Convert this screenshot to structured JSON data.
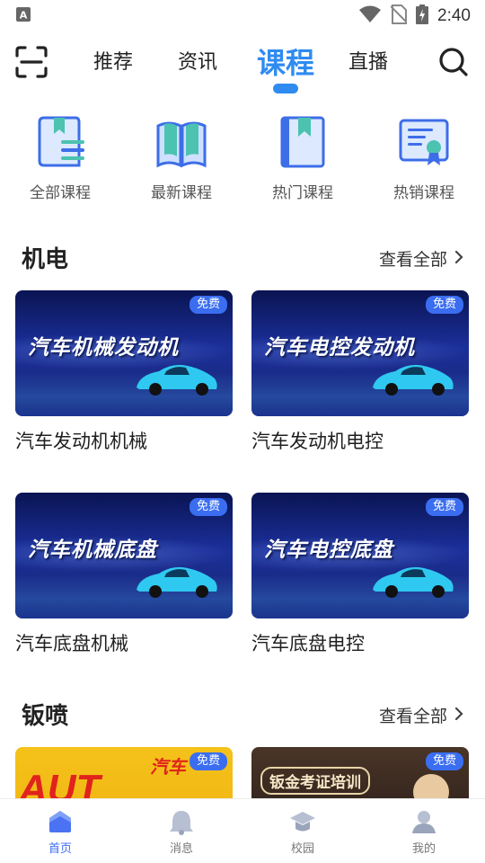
{
  "status_bar": {
    "time": "2:40"
  },
  "top_nav": {
    "tabs": [
      {
        "label": "推荐"
      },
      {
        "label": "资讯"
      },
      {
        "label": "课程"
      },
      {
        "label": "直播"
      }
    ],
    "active_tab": "课程",
    "accent_color": "#2f8bf0"
  },
  "categories": [
    {
      "label": "全部课程",
      "icon": "book-list-icon"
    },
    {
      "label": "最新课程",
      "icon": "open-book-icon"
    },
    {
      "label": "热门课程",
      "icon": "bookmark-book-icon"
    },
    {
      "label": "热销课程",
      "icon": "certificate-icon"
    }
  ],
  "sections": [
    {
      "title": "机电",
      "see_all": "查看全部",
      "courses": [
        {
          "thumb_text": "汽车机械发动机",
          "badge": "免费",
          "title": "汽车发动机机械"
        },
        {
          "thumb_text": "汽车电控发动机",
          "badge": "免费",
          "title": "汽车发动机电控"
        },
        {
          "thumb_text": "汽车机械底盘",
          "badge": "免费",
          "title": "汽车底盘机械"
        },
        {
          "thumb_text": "汽车电控底盘",
          "badge": "免费",
          "title": "汽车底盘电控"
        }
      ]
    },
    {
      "title": "钣喷",
      "see_all": "查看全部",
      "courses": [
        {
          "thumb_text": "汽车",
          "badge": "免费",
          "title": ""
        },
        {
          "thumb_text": "钣金考证培训",
          "badge": "免费",
          "title": ""
        }
      ]
    }
  ],
  "bottom_nav": [
    {
      "label": "首页",
      "icon": "home-icon",
      "active": true
    },
    {
      "label": "消息",
      "icon": "bell-icon",
      "active": false
    },
    {
      "label": "校园",
      "icon": "graduation-cap-icon",
      "active": false
    },
    {
      "label": "我的",
      "icon": "user-icon",
      "active": false
    }
  ],
  "colors": {
    "badge": "#3a6df0",
    "bottom_active": "#3e6df2"
  }
}
